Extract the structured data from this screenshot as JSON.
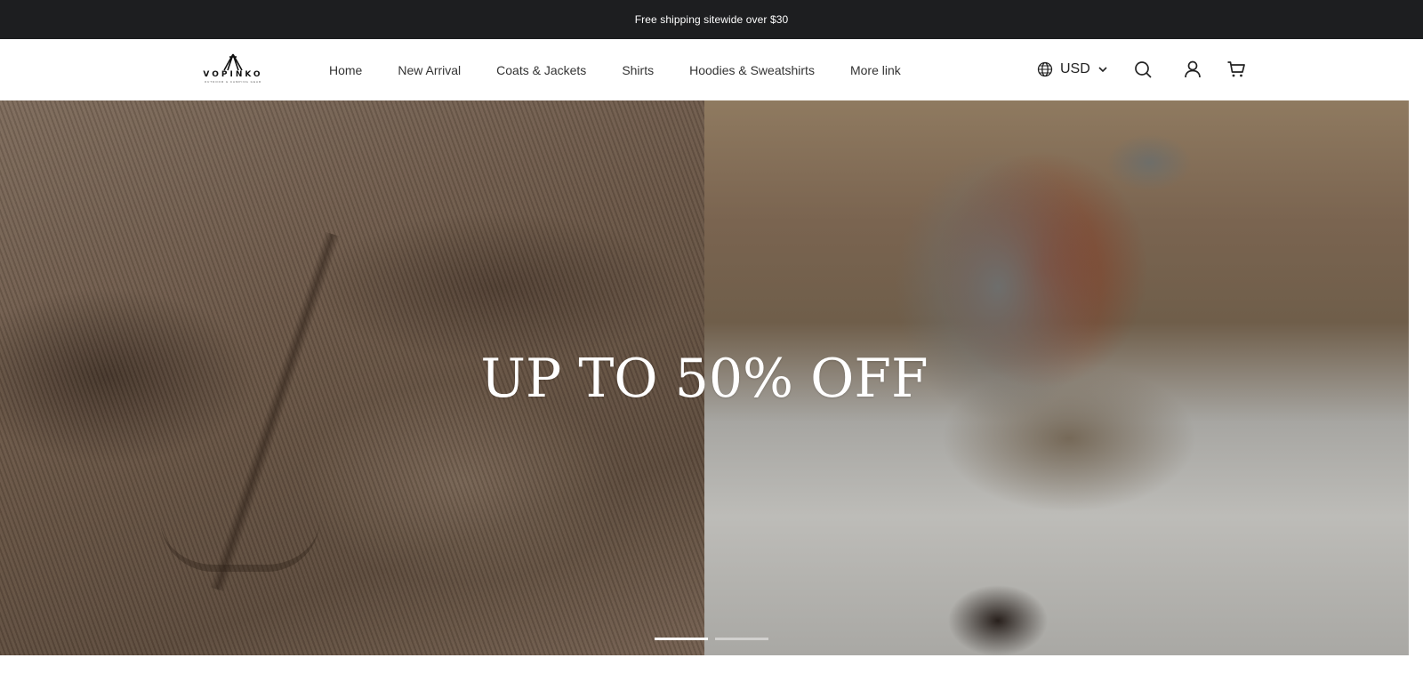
{
  "announcement": {
    "text": "Free shipping sitewide over $30"
  },
  "brand": {
    "name": "VOPINKO",
    "tagline": "OUTDOOR & CAMPING GEAR"
  },
  "nav": {
    "items": [
      {
        "label": "Home"
      },
      {
        "label": "New Arrival"
      },
      {
        "label": "Coats & Jackets"
      },
      {
        "label": "Shirts"
      },
      {
        "label": "Hoodies & Sweatshirts"
      },
      {
        "label": "More link"
      }
    ]
  },
  "header": {
    "currency": "USD",
    "icons": [
      "globe-icon",
      "chevron-down-icon",
      "search-icon",
      "account-icon",
      "cart-icon"
    ]
  },
  "hero": {
    "title": "UP TO 50% OFF",
    "slides_total": 2,
    "active_slide": 1
  },
  "colors": {
    "announcement_bg": "#1d1e20",
    "header_bg": "#ffffff",
    "hero_text": "#ffffff"
  }
}
